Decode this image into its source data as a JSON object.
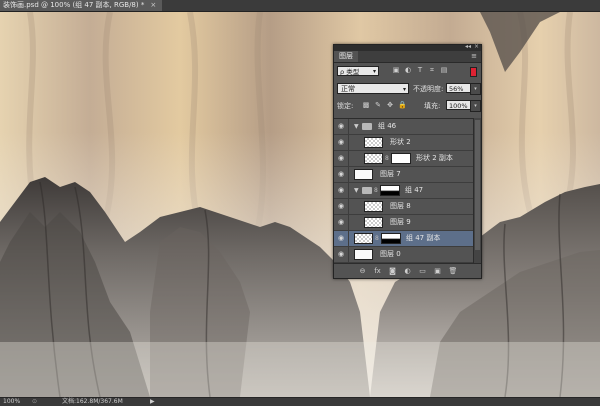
{
  "document": {
    "tab_title": "装饰画.psd @ 100% (组 47 副本, RGB/8) *",
    "close_glyph": "×"
  },
  "status_bar": {
    "zoom": "100%",
    "doc_info": "文档:162.8M/367.6M",
    "arrow": "▶"
  },
  "layers_panel": {
    "collapse_glyph": "◂◂",
    "close_glyph": "×",
    "title": "图层",
    "menu_glyph": "≡",
    "filter": {
      "kind_label": "ρ 类型",
      "icons": [
        "image-filter-icon",
        "adjustment-filter-icon",
        "type-filter-icon",
        "shape-filter-icon",
        "smart-object-filter-icon"
      ],
      "icon_glyphs": [
        "▣",
        "◐",
        "T",
        "⌗",
        "▤"
      ]
    },
    "blend_mode": "正常",
    "opacity_label": "不透明度:",
    "opacity_value": "56%",
    "lock_label": "锁定:",
    "lock_icon_glyphs": [
      "▩",
      "✎",
      "✥",
      "🔒"
    ],
    "fill_label": "填充:",
    "fill_value": "100%",
    "stepper_glyph": "▾",
    "layers": [
      {
        "type": "group",
        "name": "组 46",
        "expanded": true,
        "indent": 0
      },
      {
        "type": "layer",
        "name": "形状 2",
        "indent": 1,
        "thumb": "checker"
      },
      {
        "type": "layer",
        "name": "形状 2 副本",
        "indent": 1,
        "thumb": "checker",
        "mask": "white"
      },
      {
        "type": "layer",
        "name": "图层 7",
        "indent": 0,
        "thumb": "white"
      },
      {
        "type": "group",
        "name": "组 47",
        "expanded": true,
        "indent": 0,
        "mask": "gradient"
      },
      {
        "type": "layer",
        "name": "图层 8",
        "indent": 1,
        "thumb": "checker"
      },
      {
        "type": "layer",
        "name": "图层 9",
        "indent": 1,
        "thumb": "checker"
      },
      {
        "type": "group",
        "name": "组 47 副本",
        "indent": 0,
        "thumb": "checker",
        "mask": "gradient",
        "selected": true
      },
      {
        "type": "layer",
        "name": "图层 0",
        "indent": 0,
        "thumb": "white"
      }
    ],
    "footer_glyphs": [
      "⊖",
      "fx",
      "◙",
      "◐",
      "▭",
      "▣",
      "🗑"
    ]
  },
  "colors": {
    "panel_bg": "#535353",
    "selected_row": "#5d6f8a",
    "app_bg": "#3a3a3a"
  }
}
